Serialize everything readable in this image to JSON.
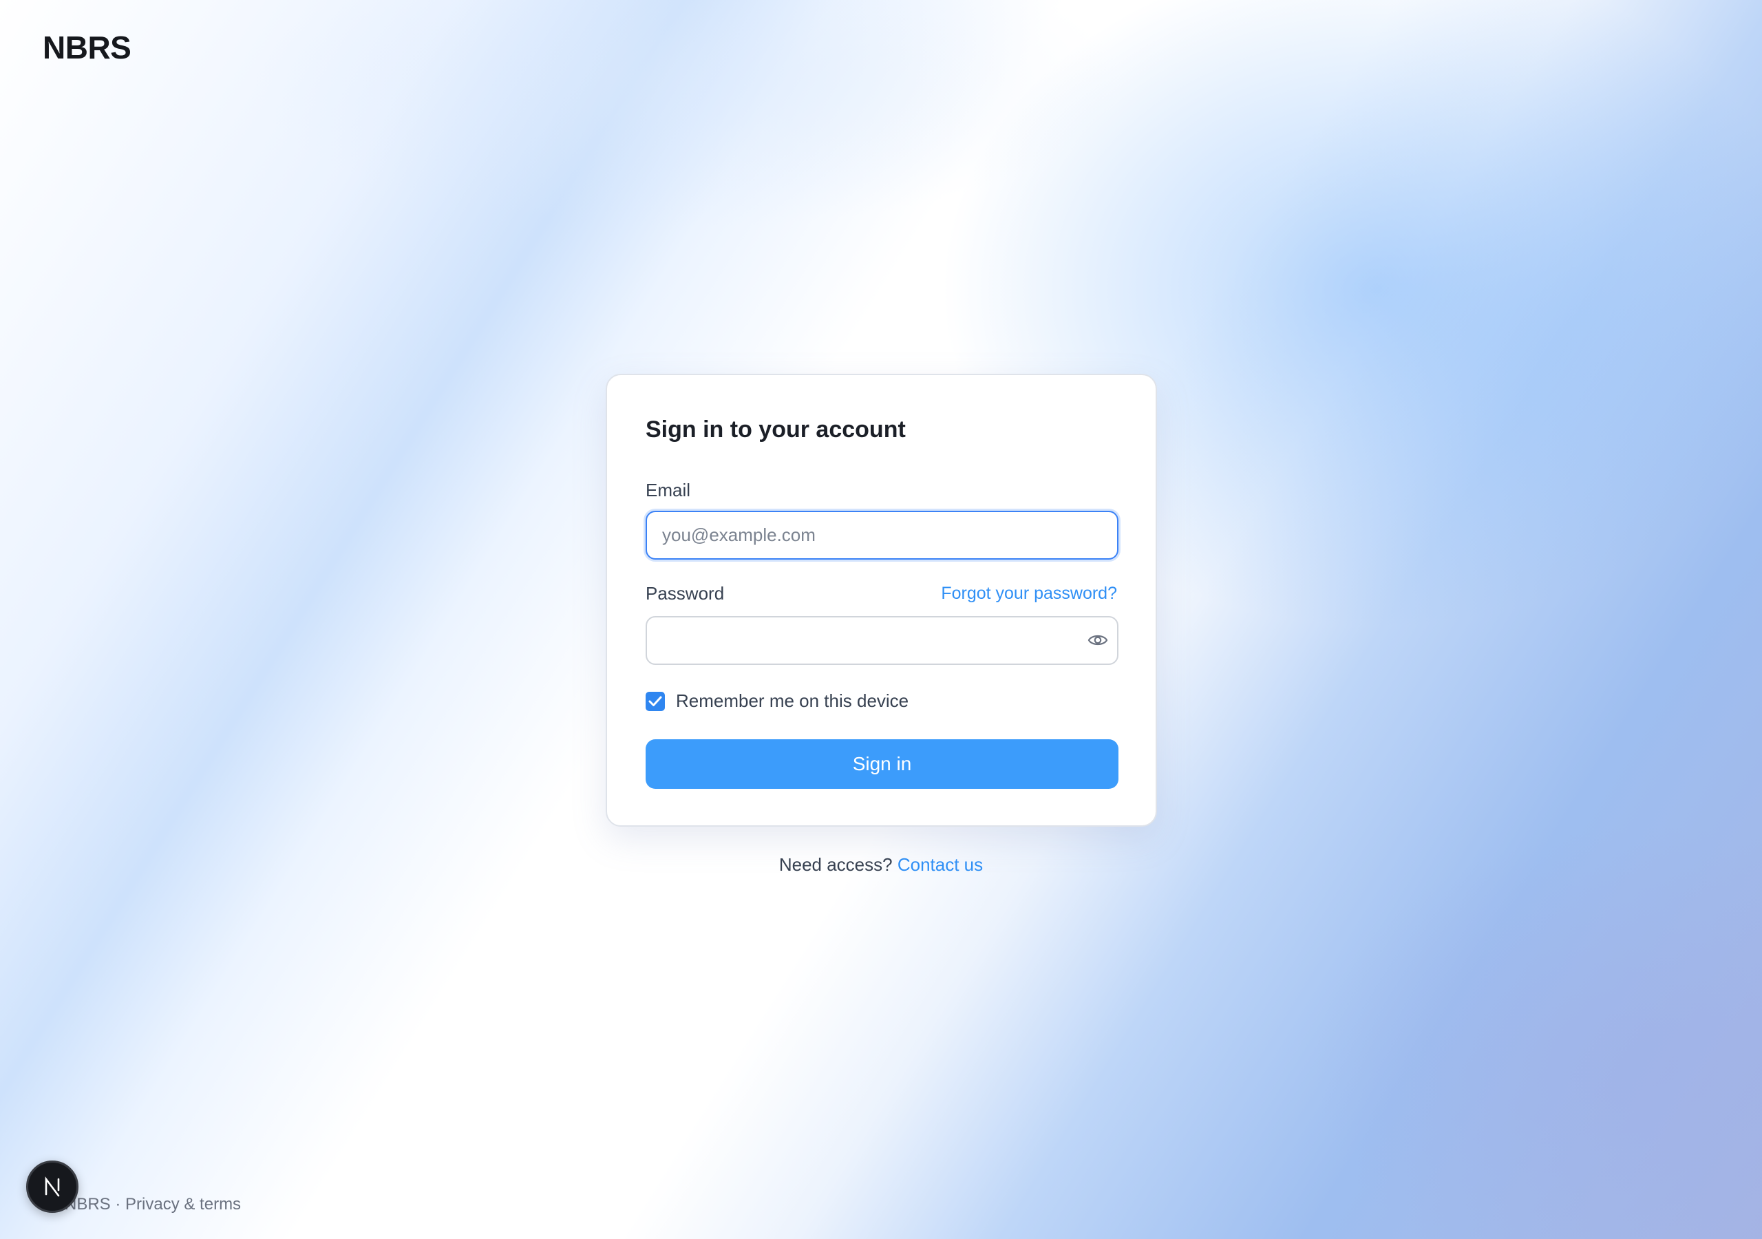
{
  "brand": {
    "name": "NBRS"
  },
  "login_card": {
    "title": "Sign in to your account",
    "email_label": "Email",
    "email_placeholder": "you@example.com",
    "email_value": "",
    "password_label": "Password",
    "password_value": "",
    "forgot_link": "Forgot your password?",
    "toggle_visibility_icon": "eye-icon",
    "remember_label": "Remember me on this device",
    "remember_checked": true,
    "submit_label": "Sign in"
  },
  "access": {
    "prompt": "Need access?",
    "link": "Contact us"
  },
  "footer": {
    "brand": "NBRS",
    "separator": "·",
    "terms": "Privacy & terms"
  },
  "dev_badge": {
    "letter": "N"
  },
  "colors": {
    "accent": "#3c9cfb",
    "link": "#2f8ff5",
    "focus_ring": "#3b82f6"
  }
}
